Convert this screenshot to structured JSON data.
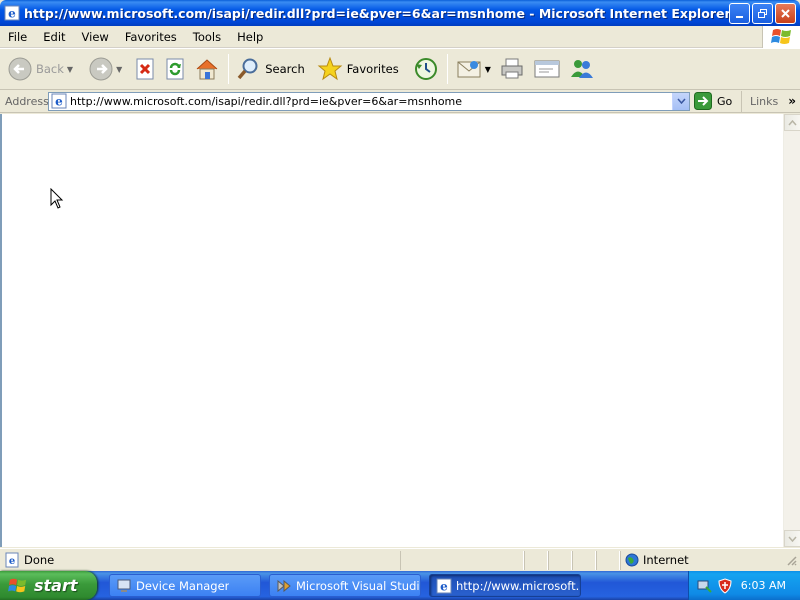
{
  "window": {
    "title": "http://www.microsoft.com/isapi/redir.dll?prd=ie&pver=6&ar=msnhome - Microsoft Internet Explorer"
  },
  "menu": {
    "items": [
      "File",
      "Edit",
      "View",
      "Favorites",
      "Tools",
      "Help"
    ]
  },
  "toolbar": {
    "back_label": "Back",
    "search_label": "Search",
    "favorites_label": "Favorites"
  },
  "address_bar": {
    "label": "Address",
    "url": "http://www.microsoft.com/isapi/redir.dll?prd=ie&pver=6&ar=msnhome",
    "go_label": "Go",
    "links_label": "Links"
  },
  "status_bar": {
    "status": "Done",
    "zone": "Internet"
  },
  "taskbar": {
    "start_label": "start",
    "tasks": [
      {
        "label": "Device Manager",
        "active": false
      },
      {
        "label": "Microsoft Visual Studi...",
        "active": false
      },
      {
        "label": "http://www.microsoft....",
        "active": true
      }
    ],
    "clock": "6:03 AM"
  },
  "icons": {
    "app": "ie-icon",
    "back": "back-arrow-icon",
    "forward": "forward-arrow-icon",
    "stop": "stop-icon",
    "refresh": "refresh-icon",
    "home": "home-icon",
    "search": "search-icon",
    "favorites": "star-icon",
    "history": "history-icon",
    "mail": "mail-icon",
    "print": "printer-icon",
    "edit": "edit-icon",
    "messenger": "messenger-icon"
  },
  "colors": {
    "titlebar": "#0055e5",
    "taskbar": "#2157d7",
    "start": "#3a9a3a",
    "chrome": "#ece9d8"
  }
}
